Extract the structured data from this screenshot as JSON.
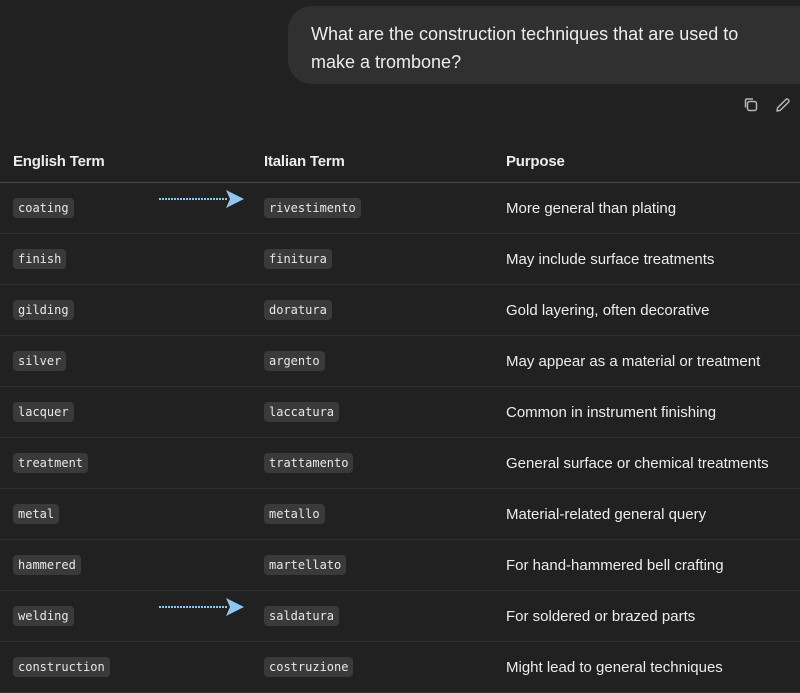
{
  "user_message": "What are the construction techniques that are used to make a trombone?",
  "message_actions": [
    {
      "icon": "copy-icon"
    },
    {
      "icon": "edit-icon"
    }
  ],
  "table": {
    "headers": [
      "English Term",
      "Italian Term",
      "Purpose"
    ],
    "rows": [
      {
        "english": "coating",
        "italian": "rivestimento",
        "purpose": "More general than plating",
        "arrow": true
      },
      {
        "english": "finish",
        "italian": "finitura",
        "purpose": "May include surface treatments",
        "arrow": false
      },
      {
        "english": "gilding",
        "italian": "doratura",
        "purpose": "Gold layering, often decorative",
        "arrow": false
      },
      {
        "english": "silver",
        "italian": "argento",
        "purpose": "May appear as a material or treatment",
        "arrow": false
      },
      {
        "english": "lacquer",
        "italian": "laccatura",
        "purpose": "Common in instrument finishing",
        "arrow": false
      },
      {
        "english": "treatment",
        "italian": "trattamento",
        "purpose": "General surface or chemical treatments",
        "arrow": false
      },
      {
        "english": "metal",
        "italian": "metallo",
        "purpose": "Material-related general query",
        "arrow": false
      },
      {
        "english": "hammered",
        "italian": "martellato",
        "purpose": "For hand-hammered bell crafting",
        "arrow": false
      },
      {
        "english": "welding",
        "italian": "saldatura",
        "purpose": "For soldered or brazed parts",
        "arrow": true
      },
      {
        "english": "construction",
        "italian": "costruzione",
        "purpose": "Might lead to general techniques",
        "arrow": false
      }
    ]
  },
  "colors": {
    "background": "#212121",
    "bubble": "#303030",
    "arrow": "#8fc6ee"
  }
}
